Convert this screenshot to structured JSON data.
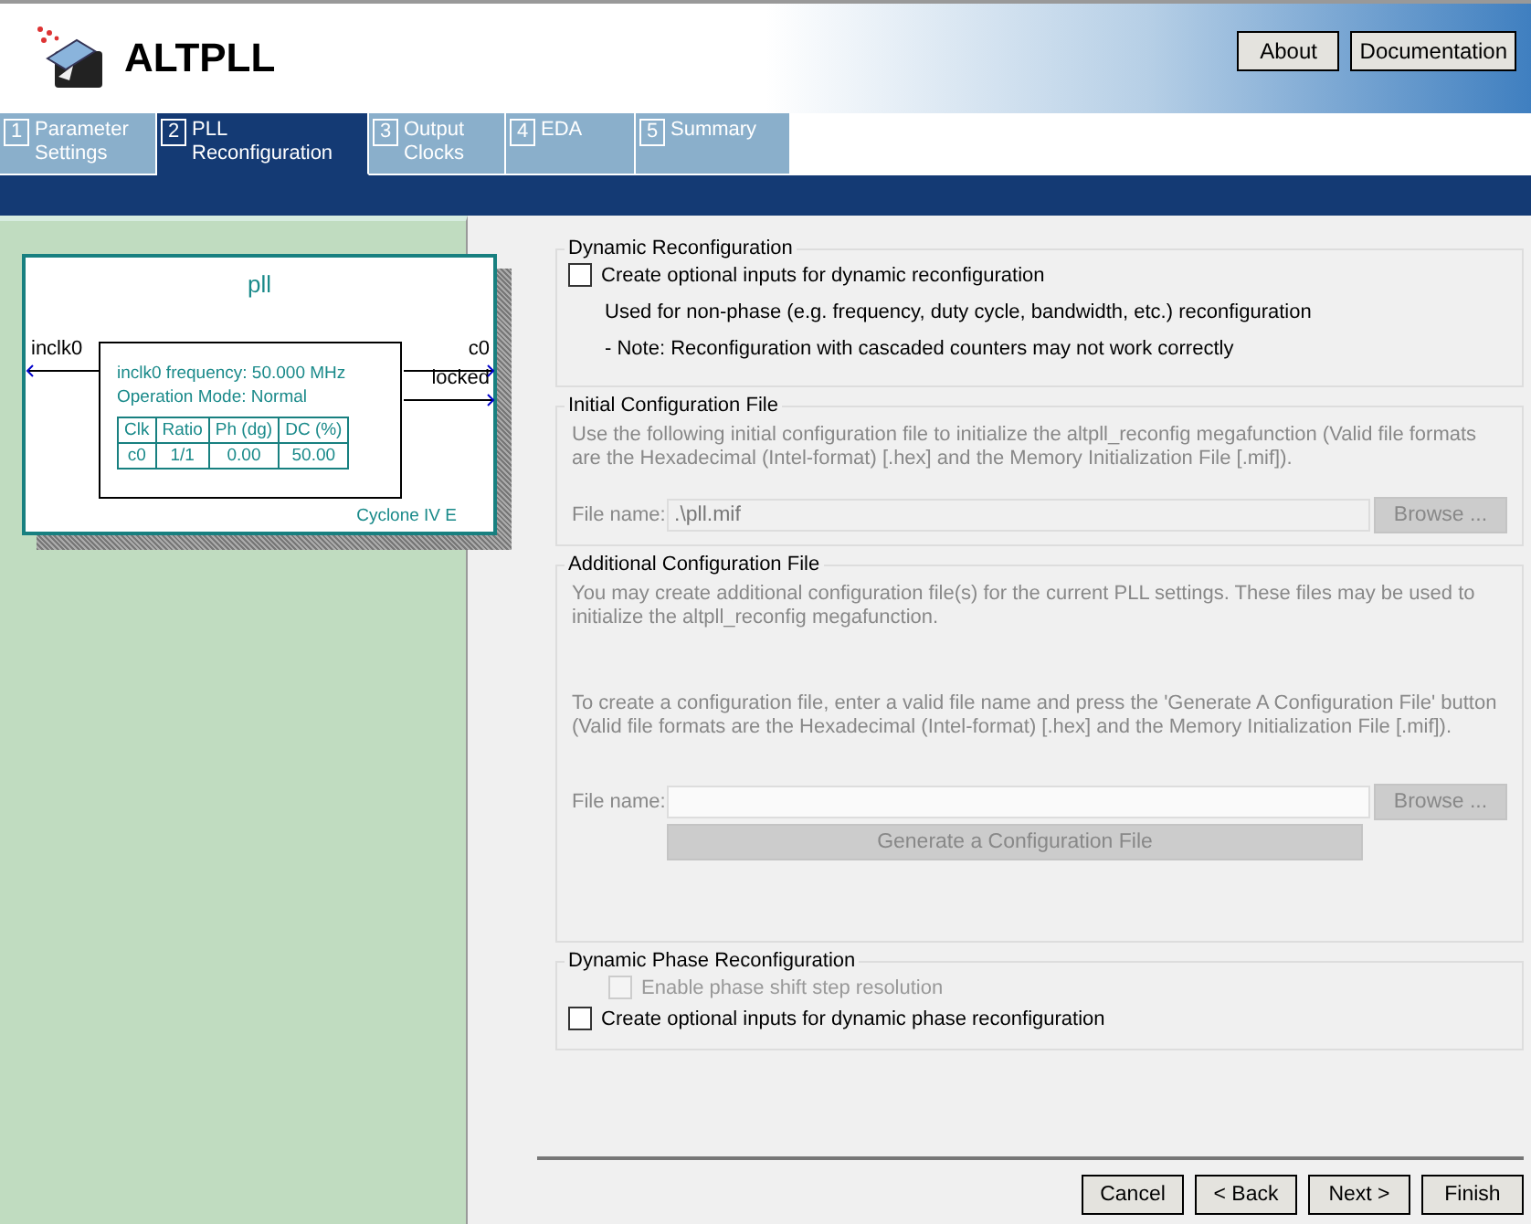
{
  "header": {
    "title": "ALTPLL",
    "buttons": [
      "About",
      "Documentation"
    ]
  },
  "tabs": [
    {
      "number": "1",
      "lines": [
        "Parameter",
        "Settings"
      ],
      "selected": false
    },
    {
      "number": "2",
      "lines": [
        "PLL",
        "Reconfiguration"
      ],
      "selected": true
    },
    {
      "number": "3",
      "lines": [
        "Output",
        "Clocks"
      ],
      "selected": false
    },
    {
      "number": "4",
      "lines": [
        "EDA"
      ],
      "selected": false
    },
    {
      "number": "5",
      "lines": [
        "Summary"
      ],
      "selected": false
    }
  ],
  "diagram": {
    "title": "pll",
    "input": "inclk0",
    "outputs": [
      "c0",
      "locked"
    ],
    "info": [
      "inclk0 frequency: 50.000 MHz",
      "Operation Mode: Normal"
    ],
    "table": {
      "columns": [
        "Clk",
        "Ratio",
        "Ph (dg)",
        "DC (%)"
      ],
      "rows": [
        [
          "c0",
          "1/1",
          "0.00",
          "50.00"
        ]
      ]
    },
    "device": "Cyclone IV E"
  },
  "dynamic_reconfiguration": {
    "legend": "Dynamic Reconfiguration",
    "checkbox": {
      "label": "Create optional inputs for dynamic reconfiguration",
      "checked": false
    },
    "notes": [
      "Used for non-phase (e.g. frequency, duty cycle, bandwidth, etc.) reconfiguration",
      "- Note: Reconfiguration with cascaded counters may not work correctly"
    ]
  },
  "initial_configuration_file": {
    "legend": "Initial Configuration File",
    "disabled": true,
    "description": "Use the following initial configuration file to initialize the altpll_reconfig megafunction (Valid file formats are the Hexadecimal (Intel-format) [.hex] and the Memory Initialization File [.mif]).",
    "file_label": "File name:",
    "file_value": ".\\pll.mif",
    "browse": "Browse ..."
  },
  "additional_configuration_file": {
    "legend": "Additional Configuration File",
    "disabled": true,
    "paragraphs": [
      "You may create additional configuration file(s) for the current PLL settings. These files may be used to initialize the altpll_reconfig megafunction.",
      "To create a configuration file, enter a valid file name and press the 'Generate A Configuration File' button (Valid file formats are the Hexadecimal (Intel-format) [.hex] and the Memory Initialization File [.mif])."
    ],
    "file_label": "File name:",
    "browse": "Browse ...",
    "generate": "Generate a Configuration File"
  },
  "dynamic_phase_reconfiguration": {
    "legend": "Dynamic Phase Reconfiguration",
    "checkboxes": [
      {
        "label": "Enable phase shift step resolution",
        "checked": false,
        "disabled": true
      },
      {
        "label": "Create optional inputs for dynamic phase reconfiguration",
        "checked": false,
        "disabled": false
      }
    ]
  },
  "footer_buttons": [
    "Cancel",
    "< Back",
    "Next >",
    "Finish"
  ]
}
